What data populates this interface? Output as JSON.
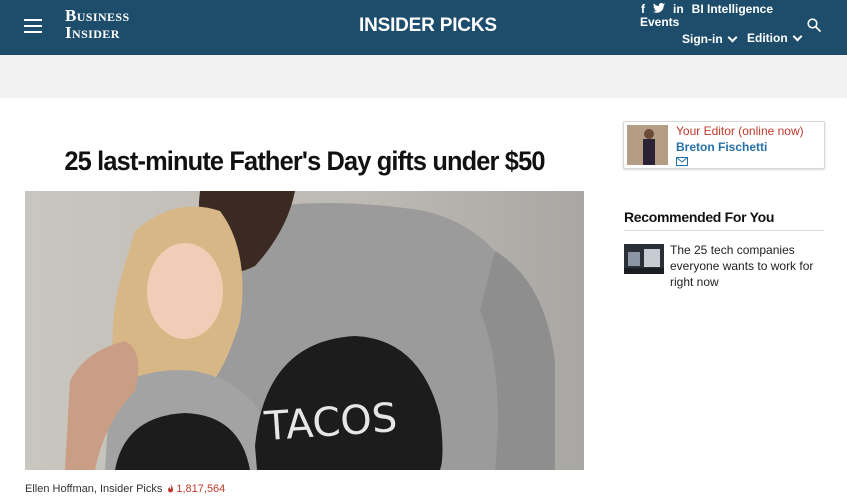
{
  "header": {
    "logo_line1": "Business",
    "logo_line2": "Insider",
    "section_title": "INSIDER PICKS",
    "social_icons": [
      "facebook-icon",
      "twitter-icon",
      "linkedin-icon"
    ],
    "bi_intelligence": "BI Intelligence",
    "events": "Events",
    "signin": "Sign-in",
    "edition": "Edition"
  },
  "article": {
    "headline": "25 last-minute Father's Day gifts under $50",
    "hero_shirt_text": "TACOS",
    "author": "Ellen Hoffman, Insider Picks",
    "views": "1,817,564"
  },
  "sidebar": {
    "editor_title": "Your Editor (online now)",
    "editor_name": "Breton Fischetti",
    "recommended_title": "Recommended For You",
    "recommended": [
      {
        "text": "The 25 tech companies everyone wants to work for right now"
      }
    ]
  },
  "colors": {
    "header_bg": "#1d4d6b",
    "accent_red": "#c0392b",
    "link_blue": "#2670a8"
  }
}
